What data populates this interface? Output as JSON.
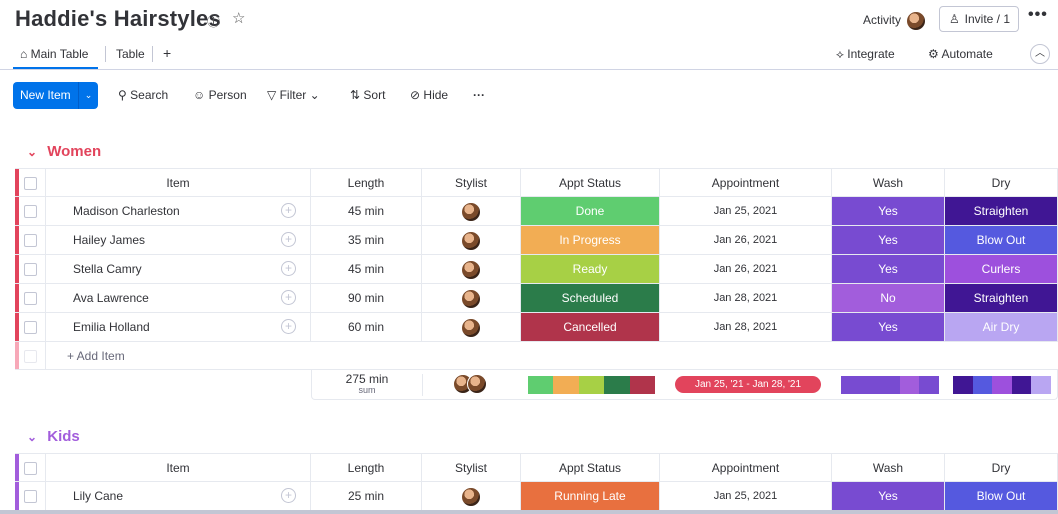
{
  "board": {
    "title": "Haddie's Hairstyles",
    "activity_label": "Activity",
    "invite_label": "Invite / 1",
    "more_label": "•••"
  },
  "views": {
    "tabs": [
      "Main Table",
      "Table"
    ],
    "add_label": "+",
    "integrate_label": "Integrate",
    "automate_label": "Automate"
  },
  "toolbar": {
    "new_item_label": "New Item",
    "search_label": "Search",
    "person_label": "Person",
    "filter_label": "Filter",
    "sort_label": "Sort",
    "hide_label": "Hide",
    "more_label": "···"
  },
  "columns": [
    "Item",
    "Length",
    "Stylist",
    "Appt Status",
    "Appointment",
    "Wash",
    "Dry"
  ],
  "groups": [
    {
      "name": "Women",
      "color": "#e2445c",
      "rows": [
        {
          "item": "Madison Charleston",
          "length": "45 min",
          "status": "Done",
          "status_color": "#5fcd70",
          "date": "Jan 25, 2021",
          "wash": "Yes",
          "wash_color": "#784bd1",
          "dry": "Straighten",
          "dry_color": "#401694"
        },
        {
          "item": "Hailey James",
          "length": "35 min",
          "status": "In Progress",
          "status_color": "#f2ad54",
          "date": "Jan 26, 2021",
          "wash": "Yes",
          "wash_color": "#784bd1",
          "dry": "Blow Out",
          "dry_color": "#5559df"
        },
        {
          "item": "Stella Camry",
          "length": "45 min",
          "status": "Ready",
          "status_color": "#a7d045",
          "date": "Jan 26, 2021",
          "wash": "Yes",
          "wash_color": "#784bd1",
          "dry": "Curlers",
          "dry_color": "#9d50dd"
        },
        {
          "item": "Ava Lawrence",
          "length": "90 min",
          "status": "Scheduled",
          "status_color": "#2b7c4a",
          "date": "Jan 28, 2021",
          "wash": "No",
          "wash_color": "#a25ddc",
          "dry": "Straighten",
          "dry_color": "#401694"
        },
        {
          "item": "Emilia Holland",
          "length": "60 min",
          "status": "Cancelled",
          "status_color": "#b0344b",
          "date": "Jan 28, 2021",
          "wash": "Yes",
          "wash_color": "#784bd1",
          "dry": "Air Dry",
          "dry_color": "#b9a6f2"
        }
      ],
      "add_item_label": "+ Add Item",
      "summary": {
        "length_total": "275 min",
        "length_label": "sum",
        "date_range": "Jan 25, '21 - Jan 28, '21"
      }
    },
    {
      "name": "Kids",
      "color": "#a25ddc",
      "rows": [
        {
          "item": "Lily Cane",
          "length": "25 min",
          "status": "Running Late",
          "status_color": "#e8703f",
          "date": "Jan 25, 2021",
          "wash": "Yes",
          "wash_color": "#784bd1",
          "dry": "Blow Out",
          "dry_color": "#5559df"
        }
      ]
    }
  ]
}
